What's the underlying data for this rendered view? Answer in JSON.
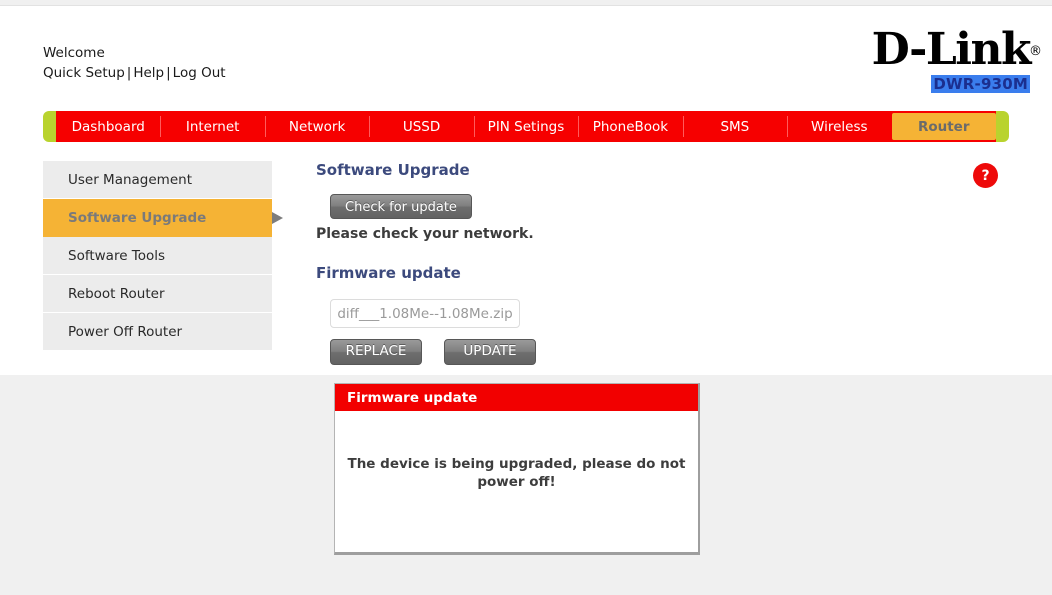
{
  "header": {
    "welcome": "Welcome",
    "links": [
      {
        "label": "Quick Setup"
      },
      {
        "label": "Help"
      },
      {
        "label": "Log Out"
      }
    ],
    "separator": "|",
    "brand": "D-Link",
    "brand_reg": "®",
    "model": "DWR-930M"
  },
  "nav": {
    "items": [
      {
        "label": "Dashboard",
        "active": false
      },
      {
        "label": "Internet",
        "active": false
      },
      {
        "label": "Network",
        "active": false
      },
      {
        "label": "USSD",
        "active": false
      },
      {
        "label": "PIN Setings",
        "active": false
      },
      {
        "label": "PhoneBook",
        "active": false
      },
      {
        "label": "SMS",
        "active": false
      },
      {
        "label": "Wireless",
        "active": false
      },
      {
        "label": "Router",
        "active": true
      }
    ],
    "accent_color": "#b9d32e",
    "bar_color": "#f60000",
    "active_color": "#f5b335"
  },
  "sidebar": {
    "items": [
      {
        "label": "User Management",
        "active": false
      },
      {
        "label": "Software Upgrade",
        "active": true
      },
      {
        "label": "Software Tools",
        "active": false
      },
      {
        "label": "Reboot Router",
        "active": false
      },
      {
        "label": "Power Off Router",
        "active": false
      }
    ]
  },
  "main": {
    "title": "Software Upgrade",
    "check_button": "Check for update",
    "status": "Please check your network.",
    "firmware_title": "Firmware update",
    "file_value": "diff___1.08Me--1.08Me.zip",
    "replace_button": "REPLACE",
    "update_button": "UPDATE",
    "help_glyph": "?"
  },
  "modal": {
    "title": "Firmware update",
    "message": "The device is being upgraded, please do not power off!",
    "header_color": "#f20000"
  }
}
